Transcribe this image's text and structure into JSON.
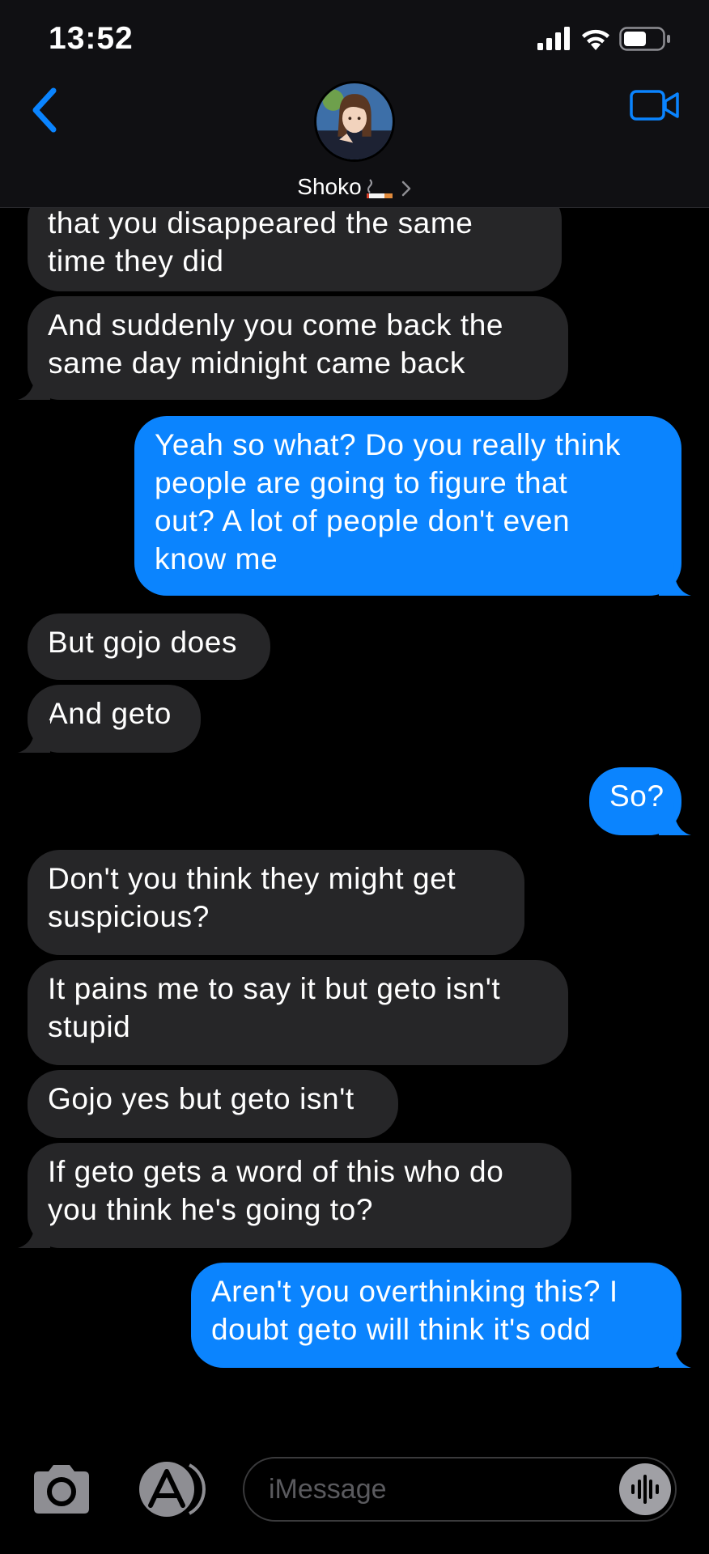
{
  "status_bar": {
    "time": "13:52"
  },
  "header": {
    "contact_name": "Shoko"
  },
  "messages": [
    {
      "dir": "recv",
      "lines": [
        "that you disappeared the same",
        "time they did"
      ]
    },
    {
      "dir": "recv",
      "lines": [
        "And suddenly you come back the",
        "same day midnight came back"
      ]
    },
    {
      "dir": "sent",
      "lines": [
        "Yeah so what? Do you really think",
        "people are going to figure that",
        "out? A lot of people don't even",
        "know me"
      ]
    },
    {
      "dir": "recv",
      "lines": [
        "But gojo does"
      ]
    },
    {
      "dir": "recv",
      "lines": [
        "And geto"
      ]
    },
    {
      "dir": "sent",
      "lines": [
        "So?"
      ]
    },
    {
      "dir": "recv",
      "lines": [
        "Don't you think they might get",
        "suspicious?"
      ]
    },
    {
      "dir": "recv",
      "lines": [
        "It pains me to say it but geto isn't",
        "stupid"
      ]
    },
    {
      "dir": "recv",
      "lines": [
        "Gojo yes but geto isn't"
      ]
    },
    {
      "dir": "recv",
      "lines": [
        "If geto gets a word of this who do",
        "you think he's going to?"
      ]
    },
    {
      "dir": "sent",
      "lines": [
        "Aren't you overthinking this? I",
        "doubt geto will think it's odd"
      ]
    }
  ],
  "input_bar": {
    "placeholder": "iMessage"
  },
  "icons": {
    "back": "chevron-left-icon",
    "video": "video-camera-icon",
    "camera": "camera-icon",
    "apps": "app-store-icon",
    "audio": "waveform-icon",
    "name_emoji": "cigarette-emoji"
  },
  "colors": {
    "sent_bubble": "#0b84fe",
    "received_bubble": "#262628",
    "accent": "#0a84ff",
    "background": "#000000",
    "header_bg": "#101013"
  }
}
